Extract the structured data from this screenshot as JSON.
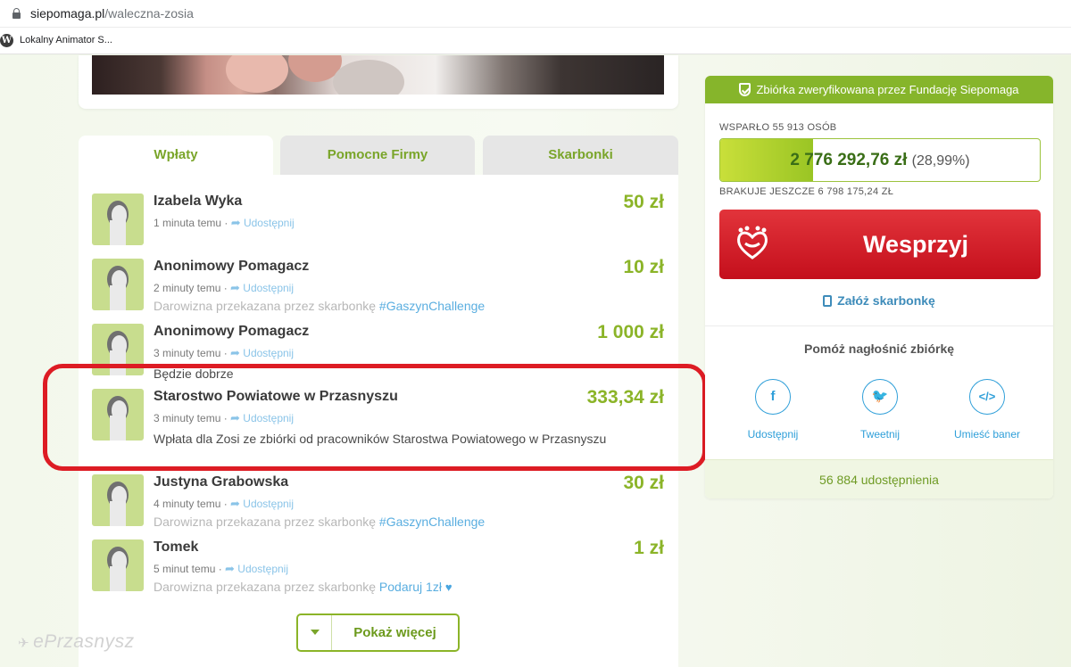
{
  "browser": {
    "url_domain": "siepomaga.pl",
    "url_path": "/waleczna-zosia",
    "bookmark_label": "Lokalny Animator S...",
    "bookmark_icon": "wordpress-icon"
  },
  "tabs": [
    {
      "label": "Wpłaty",
      "active": true
    },
    {
      "label": "Pomocne Firmy",
      "active": false
    },
    {
      "label": "Skarbonki",
      "active": false
    }
  ],
  "donations": [
    {
      "name": "Izabela Wyka",
      "amount": "50 zł",
      "time": "1 minuta temu",
      "share": "Udostępnij",
      "message": ""
    },
    {
      "name": "Anonimowy Pomagacz",
      "amount": "10 zł",
      "time": "2 minuty temu",
      "share": "Udostępnij",
      "message_prefix": "Darowizna przekazana przez skarbonkę",
      "message_tag": "#GaszynChallenge"
    },
    {
      "name": "Anonimowy Pomagacz",
      "amount": "1 000 zł",
      "time": "3 minuty temu",
      "share": "Udostępnij",
      "message": "Będzie dobrze"
    },
    {
      "name": "Starostwo Powiatowe w Przasnyszu",
      "amount": "333,34 zł",
      "time": "3 minuty temu",
      "share": "Udostępnij",
      "message": "Wpłata dla Zosi ze zbiórki od pracowników Starostwa Powiatowego w Przasnyszu"
    },
    {
      "name": "Justyna Grabowska",
      "amount": "30 zł",
      "time": "4 minuty temu",
      "share": "Udostępnij",
      "message_prefix": "Darowizna przekazana przez skarbonkę",
      "message_tag": "#GaszynChallenge"
    },
    {
      "name": "Tomek",
      "amount": "1 zł",
      "time": "5 minut temu",
      "share": "Udostępnij",
      "message_prefix": "Darowizna przekazana przez skarbonkę",
      "message_tag": "Podaruj 1zł"
    }
  ],
  "show_more_label": "Pokaż więcej",
  "watermark": "ePrzasnysz",
  "sidebar": {
    "verified_label": "Zbiórka zweryfikowana przez Fundację Siepomaga",
    "supported_label": "WSPARŁO 55 913 OSÓB",
    "raised_amount": "2 776 292,76 zł",
    "raised_percent": "(28,99%)",
    "progress_fraction": 0.2899,
    "missing_label": "BRAKUJE JESZCZE 6 798 175,24 ZŁ",
    "donate_label": "Wesprzyj",
    "piggybank_label": "Załóż skarbonkę",
    "help_label": "Pomóż nagłośnić zbiórkę",
    "social": [
      {
        "label": "Udostępnij",
        "icon": "facebook-icon",
        "glyph": "f"
      },
      {
        "label": "Tweetnij",
        "icon": "twitter-icon",
        "glyph": "🐦"
      },
      {
        "label": "Umieść baner",
        "icon": "code-icon",
        "glyph": "</>"
      }
    ],
    "shares_label": "56 884 udostępnienia"
  },
  "colors": {
    "accent_green": "#8bb428",
    "donate_red": "#d01d27",
    "link_blue": "#2f9fd9",
    "highlight_red": "#dd1c24"
  }
}
